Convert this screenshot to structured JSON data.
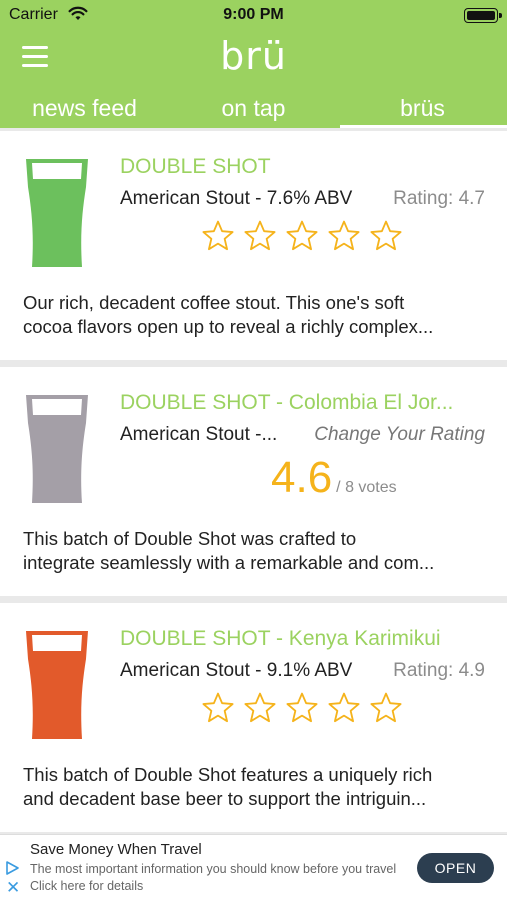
{
  "status_bar": {
    "carrier": "Carrier",
    "time": "9:00 PM",
    "wifi_icon": "wifi-icon",
    "battery_level": 1.0
  },
  "header": {
    "logo": "brü",
    "menu_icon": "hamburger-menu-icon",
    "tabs": [
      {
        "label": "news feed",
        "active": false
      },
      {
        "label": "on tap",
        "active": false
      },
      {
        "label": "brüs",
        "active": true
      }
    ]
  },
  "colors": {
    "brand_green": "#9bd260",
    "star_gold": "#f5b31b",
    "glass_green": "#6cc05d",
    "glass_gray": "#a49fa7",
    "glass_orange": "#e25a2b"
  },
  "beers": [
    {
      "name": "DOUBLE SHOT",
      "style": "American Stout - 7.6% ABV",
      "rating_text": "Rating: 4.7",
      "glass_color": "#6cc05d",
      "stars_total": 5,
      "stars_filled": 0,
      "description": [
        "Our rich, decadent coffee stout. This one's soft",
        "cocoa flavors open up to reveal a richly complex..."
      ]
    },
    {
      "name": "DOUBLE SHOT - Colombia El Jor...",
      "style": "American Stout -...",
      "change_rating": "Change Your Rating",
      "score": "4.6",
      "votes": "/ 8 votes",
      "glass_color": "#a49fa7",
      "description": [
        "This batch of Double Shot was crafted to",
        "integrate seamlessly with a remarkable and com..."
      ]
    },
    {
      "name": "DOUBLE SHOT - Kenya Karimikui",
      "style": "American Stout - 9.1% ABV",
      "rating_text": "Rating: 4.9",
      "glass_color": "#e25a2b",
      "stars_total": 5,
      "stars_filled": 0,
      "description": [
        "This batch of Double Shot features a uniquely rich",
        "and decadent base beer to support the intriguin..."
      ]
    }
  ],
  "ad": {
    "title": "Save Money When Travel",
    "text": "The most important information you should know before you travel Click here for details",
    "button": "OPEN",
    "play_icon": "ad-choices-play-icon",
    "close_icon": "close-icon"
  }
}
